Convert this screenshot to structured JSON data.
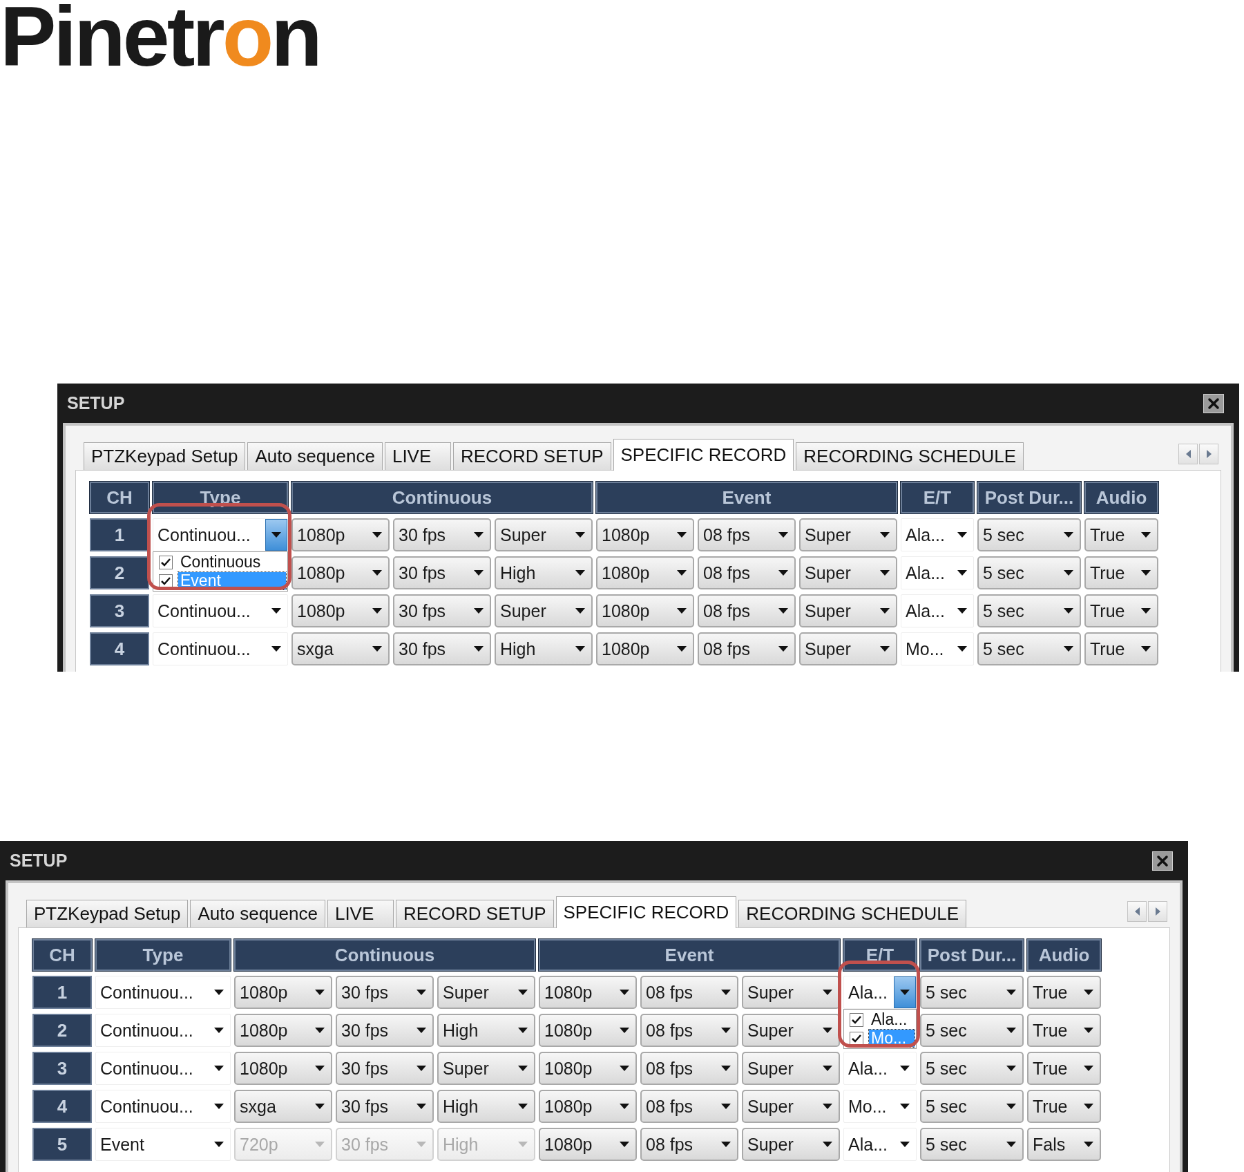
{
  "logo": {
    "parts": [
      {
        "text": "Pinetr",
        "accent": false
      },
      {
        "text": "o",
        "accent": true
      },
      {
        "text": "n",
        "accent": false
      }
    ]
  },
  "windows": [
    {
      "title": "SETUP",
      "tabs": [
        {
          "label": "PTZKeypad Setup",
          "selected": false
        },
        {
          "label": "Auto sequence",
          "selected": false
        },
        {
          "label": "LIVE",
          "selected": false
        },
        {
          "label": "RECORD SETUP",
          "selected": false
        },
        {
          "label": "SPECIFIC RECORD",
          "selected": true
        },
        {
          "label": "RECORDING SCHEDULE",
          "selected": false
        }
      ],
      "columns": [
        {
          "label": "CH",
          "kind": "channel"
        },
        {
          "label": "Type",
          "kind": "type"
        },
        {
          "label": "Continuous",
          "kind": "select"
        },
        {
          "label": "Event",
          "kind": "select"
        },
        {
          "label": "E/T",
          "kind": "mode"
        },
        {
          "label": "Post Dur...",
          "kind": "duration"
        },
        {
          "label": "Audio",
          "kind": "audio"
        }
      ],
      "rows": [
        {
          "ch": "1",
          "type": [
            {
              "value": "Continuou...",
              "disabled": false,
              "menu": {
                "callout": true,
                "items": [
                  {
                    "label": "Continuous",
                    "checked": true,
                    "selected": false
                  },
                  {
                    "label": "Event",
                    "checked": true,
                    "selected": true
                  }
                ]
              }
            }
          ],
          "continuous": [
            {
              "value": "1080p",
              "disabled": false
            },
            {
              "value": "30 fps",
              "disabled": false
            },
            {
              "value": "Super",
              "disabled": false
            }
          ],
          "event": [
            {
              "value": "1080p",
              "disabled": false
            },
            {
              "value": "08 fps",
              "disabled": false
            },
            {
              "value": "Super",
              "disabled": false
            }
          ],
          "et": [
            {
              "value": "Ala...",
              "disabled": false
            }
          ],
          "post_duration": [
            {
              "value": "5 sec",
              "disabled": false
            }
          ],
          "audio": [
            {
              "value": "True",
              "disabled": false
            }
          ]
        },
        {
          "ch": "2",
          "continuous": [
            {
              "value": "1080p",
              "disabled": false
            },
            {
              "value": "30 fps",
              "disabled": false
            },
            {
              "value": "High",
              "disabled": false
            }
          ],
          "event": [
            {
              "value": "1080p",
              "disabled": false
            },
            {
              "value": "08 fps",
              "disabled": false
            },
            {
              "value": "Super",
              "disabled": false
            }
          ],
          "et": [
            {
              "value": "Ala...",
              "disabled": false
            }
          ],
          "post_duration": [
            {
              "value": "5 sec",
              "disabled": false
            }
          ],
          "audio": [
            {
              "value": "True",
              "disabled": false
            }
          ]
        },
        {
          "ch": "3",
          "type": [
            {
              "value": "Continuou...",
              "disabled": false
            }
          ],
          "continuous": [
            {
              "value": "1080p",
              "disabled": false
            },
            {
              "value": "30 fps",
              "disabled": false
            },
            {
              "value": "Super",
              "disabled": false
            }
          ],
          "event": [
            {
              "value": "1080p",
              "disabled": false
            },
            {
              "value": "08 fps",
              "disabled": false
            },
            {
              "value": "Super",
              "disabled": false
            }
          ],
          "et": [
            {
              "value": "Ala...",
              "disabled": false
            }
          ],
          "post_duration": [
            {
              "value": "5 sec",
              "disabled": false
            }
          ],
          "audio": [
            {
              "value": "True",
              "disabled": false
            }
          ]
        },
        {
          "ch": "4",
          "type": [
            {
              "value": "Continuou...",
              "disabled": false
            }
          ],
          "continuous": [
            {
              "value": "sxga",
              "disabled": false
            },
            {
              "value": "30 fps",
              "disabled": false
            },
            {
              "value": "High",
              "disabled": false
            }
          ],
          "event": [
            {
              "value": "1080p",
              "disabled": false
            },
            {
              "value": "08 fps",
              "disabled": false
            },
            {
              "value": "Super",
              "disabled": false
            }
          ],
          "et": [
            {
              "value": "Mo...",
              "disabled": false
            }
          ],
          "post_duration": [
            {
              "value": "5 sec",
              "disabled": false
            }
          ],
          "audio": [
            {
              "value": "True",
              "disabled": false
            }
          ]
        }
      ]
    },
    {
      "title": "SETUP",
      "tabs": [
        {
          "label": "PTZKeypad Setup",
          "selected": false
        },
        {
          "label": "Auto sequence",
          "selected": false
        },
        {
          "label": "LIVE",
          "selected": false
        },
        {
          "label": "RECORD SETUP",
          "selected": false
        },
        {
          "label": "SPECIFIC RECORD",
          "selected": true
        },
        {
          "label": "RECORDING SCHEDULE",
          "selected": false
        }
      ],
      "columns": [
        {
          "label": "CH",
          "kind": "channel"
        },
        {
          "label": "Type",
          "kind": "type"
        },
        {
          "label": "Continuous",
          "kind": "select"
        },
        {
          "label": "Event",
          "kind": "select"
        },
        {
          "label": "E/T",
          "kind": "mode"
        },
        {
          "label": "Post Dur...",
          "kind": "duration"
        },
        {
          "label": "Audio",
          "kind": "audio"
        }
      ],
      "rows": [
        {
          "ch": "1",
          "type": [
            {
              "value": "Continuou...",
              "disabled": false
            }
          ],
          "continuous": [
            {
              "value": "1080p",
              "disabled": false
            },
            {
              "value": "30 fps",
              "disabled": false
            },
            {
              "value": "Super",
              "disabled": false
            }
          ],
          "event": [
            {
              "value": "1080p",
              "disabled": false
            },
            {
              "value": "08 fps",
              "disabled": false
            },
            {
              "value": "Super",
              "disabled": false
            }
          ],
          "et": [
            {
              "value": "Ala...",
              "disabled": false,
              "menu": {
                "callout": true,
                "items": [
                  {
                    "label": "Ala...",
                    "checked": true,
                    "selected": false
                  },
                  {
                    "label": "Mo...",
                    "checked": true,
                    "selected": true
                  }
                ]
              }
            }
          ],
          "post_duration": [
            {
              "value": "5 sec",
              "disabled": false
            }
          ],
          "audio": [
            {
              "value": "True",
              "disabled": false
            }
          ]
        },
        {
          "ch": "2",
          "type": [
            {
              "value": "Continuou...",
              "disabled": false
            }
          ],
          "continuous": [
            {
              "value": "1080p",
              "disabled": false
            },
            {
              "value": "30 fps",
              "disabled": false
            },
            {
              "value": "High",
              "disabled": false
            }
          ],
          "event": [
            {
              "value": "1080p",
              "disabled": false
            },
            {
              "value": "08 fps",
              "disabled": false
            },
            {
              "value": "Super",
              "disabled": false
            }
          ],
          "post_duration": [
            {
              "value": "5 sec",
              "disabled": false
            }
          ],
          "audio": [
            {
              "value": "True",
              "disabled": false
            }
          ]
        },
        {
          "ch": "3",
          "type": [
            {
              "value": "Continuou...",
              "disabled": false
            }
          ],
          "continuous": [
            {
              "value": "1080p",
              "disabled": false
            },
            {
              "value": "30 fps",
              "disabled": false
            },
            {
              "value": "Super",
              "disabled": false
            }
          ],
          "event": [
            {
              "value": "1080p",
              "disabled": false
            },
            {
              "value": "08 fps",
              "disabled": false
            },
            {
              "value": "Super",
              "disabled": false
            }
          ],
          "et": [
            {
              "value": "Ala...",
              "disabled": false
            }
          ],
          "post_duration": [
            {
              "value": "5 sec",
              "disabled": false
            }
          ],
          "audio": [
            {
              "value": "True",
              "disabled": false
            }
          ]
        },
        {
          "ch": "4",
          "type": [
            {
              "value": "Continuou...",
              "disabled": false
            }
          ],
          "continuous": [
            {
              "value": "sxga",
              "disabled": false
            },
            {
              "value": "30 fps",
              "disabled": false
            },
            {
              "value": "High",
              "disabled": false
            }
          ],
          "event": [
            {
              "value": "1080p",
              "disabled": false
            },
            {
              "value": "08 fps",
              "disabled": false
            },
            {
              "value": "Super",
              "disabled": false
            }
          ],
          "et": [
            {
              "value": "Mo...",
              "disabled": false
            }
          ],
          "post_duration": [
            {
              "value": "5 sec",
              "disabled": false
            }
          ],
          "audio": [
            {
              "value": "True",
              "disabled": false
            }
          ]
        },
        {
          "ch": "5",
          "type": [
            {
              "value": "Event",
              "disabled": false
            }
          ],
          "continuous": [
            {
              "value": "720p",
              "disabled": true
            },
            {
              "value": "30 fps",
              "disabled": true
            },
            {
              "value": "High",
              "disabled": true
            }
          ],
          "event": [
            {
              "value": "1080p",
              "disabled": false
            },
            {
              "value": "08 fps",
              "disabled": false
            },
            {
              "value": "Super",
              "disabled": false
            }
          ],
          "et": [
            {
              "value": "Ala...",
              "disabled": false
            }
          ],
          "post_duration": [
            {
              "value": "5 sec",
              "disabled": false
            }
          ],
          "audio": [
            {
              "value": "Fals",
              "disabled": false
            }
          ]
        }
      ]
    }
  ]
}
